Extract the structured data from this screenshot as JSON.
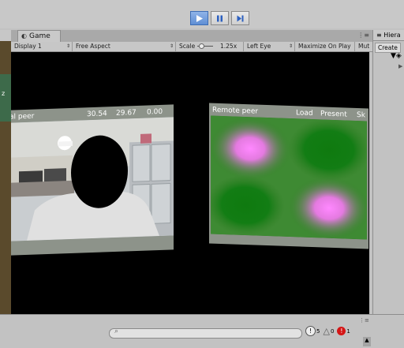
{
  "playbar": {
    "play": "▶",
    "pause": "⏸",
    "step": "⏭"
  },
  "game_tab": {
    "label": "Game"
  },
  "hierarchy": {
    "tab_label": "Hiera",
    "create_label": "Create"
  },
  "scene": {
    "axis_label": "z"
  },
  "game_controls": {
    "display": "Display 1",
    "aspect": "Free Aspect",
    "scale_label": "Scale",
    "scale_value": "1.25x",
    "eye": "Left Eye",
    "maximize": "Maximize On Play",
    "mute": "Mut"
  },
  "local_panel": {
    "title": "al peer",
    "stat1": "30.54",
    "stat2": "29.67",
    "stat3": "0.00"
  },
  "remote_panel": {
    "title": "Remote peer",
    "load": "Load",
    "present": "Present",
    "skip": "Sk"
  },
  "console_counts": {
    "info": "5",
    "warn": "0",
    "error": "1"
  },
  "colors": {
    "play_active": "#5f8fd4",
    "remote_green": "#2f7d22",
    "remote_pink": "#f07af0"
  }
}
